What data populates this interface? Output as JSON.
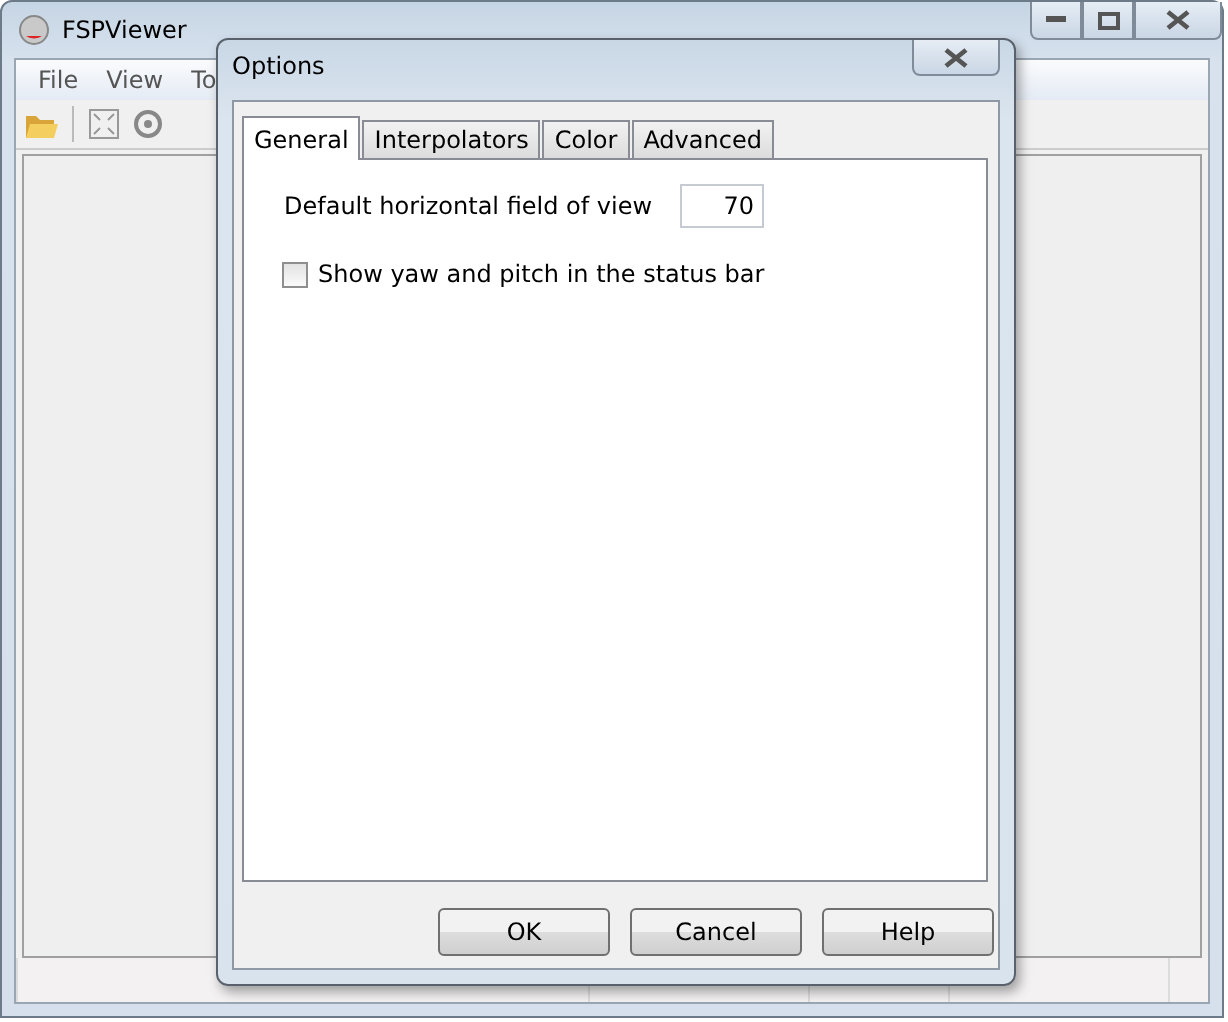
{
  "main_window": {
    "title": "FSPViewer",
    "menu": [
      "File",
      "View",
      "To"
    ]
  },
  "dialog": {
    "title": "Options",
    "tabs": [
      {
        "label": "General",
        "selected": true
      },
      {
        "label": "Interpolators",
        "selected": false
      },
      {
        "label": "Color",
        "selected": false
      },
      {
        "label": "Advanced",
        "selected": false
      }
    ],
    "field": {
      "label": "Default horizontal field of view",
      "value": "70"
    },
    "checkbox": {
      "label": "Show yaw and pitch in the status bar",
      "checked": false
    },
    "buttons": [
      "OK",
      "Cancel",
      "Help"
    ]
  }
}
